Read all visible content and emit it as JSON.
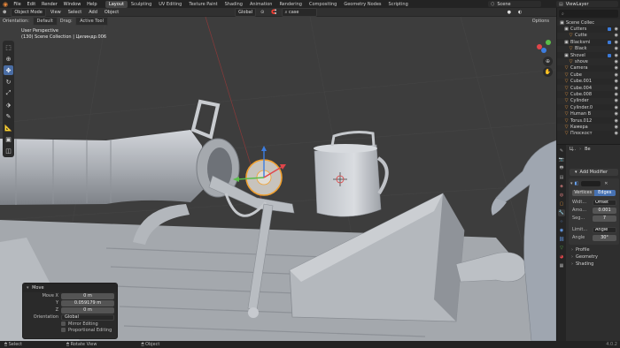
{
  "topbar": {
    "menus": [
      "File",
      "Edit",
      "Render",
      "Window",
      "Help"
    ],
    "workspaces": [
      "Layout",
      "Sculpting",
      "UV Editing",
      "Texture Paint",
      "Shading",
      "Animation",
      "Rendering",
      "Compositing",
      "Geometry Nodes",
      "Scripting"
    ],
    "active_workspace": "Layout",
    "scene": "Scene",
    "view_layer": "ViewLayer"
  },
  "header": {
    "mode": "Object Mode",
    "menus": [
      "View",
      "Select",
      "Add",
      "Object"
    ],
    "transform_orientation": "Global",
    "search_value": "case",
    "options_label": "Options"
  },
  "tool_settings": {
    "orientation_label": "Orientation:",
    "orientation_value": "Default",
    "drag_label": "Drag:",
    "drag_value": "Active Tool"
  },
  "viewport": {
    "view_name": "User Perspective",
    "collection_info": "(130) Scene Collection | Цилиндр.006"
  },
  "operator_panel": {
    "title": "Move",
    "fields": [
      {
        "label": "Move X",
        "value": "0 m"
      },
      {
        "label": "Y",
        "value": "0.059179 m"
      },
      {
        "label": "Z",
        "value": "0 m"
      }
    ],
    "orientation_label": "Orientation",
    "orientation_value": "Global",
    "checks": [
      "Mirror Editing",
      "Proportional Editing"
    ]
  },
  "statusbar": {
    "items": [
      "Select",
      "Rotate View",
      "Object"
    ],
    "version": "4.0.2"
  },
  "outliner": {
    "title": "Scene Collec",
    "rows": [
      {
        "name": "Cutters",
        "type": "collection",
        "indent": 1
      },
      {
        "name": "Cutte",
        "type": "object",
        "indent": 2
      },
      {
        "name": "Blacksmi",
        "type": "collection",
        "indent": 1
      },
      {
        "name": "Black",
        "type": "object",
        "indent": 2
      },
      {
        "name": "Shovel",
        "type": "collection",
        "indent": 1
      },
      {
        "name": "shove",
        "type": "object",
        "indent": 2
      },
      {
        "name": "Camera",
        "type": "object",
        "indent": 1
      },
      {
        "name": "Cube",
        "type": "object",
        "indent": 1
      },
      {
        "name": "Cube.001",
        "type": "object",
        "indent": 1
      },
      {
        "name": "Cube.004",
        "type": "object",
        "indent": 1
      },
      {
        "name": "Cube.008",
        "type": "object",
        "indent": 1
      },
      {
        "name": "Cylinder",
        "type": "object",
        "indent": 1
      },
      {
        "name": "Cylinder.0",
        "type": "object",
        "indent": 1
      },
      {
        "name": "Human B",
        "type": "object",
        "indent": 1
      },
      {
        "name": "Torus.012",
        "type": "object",
        "indent": 1
      },
      {
        "name": "Камера",
        "type": "object",
        "indent": 1
      },
      {
        "name": "Плоскост",
        "type": "object",
        "indent": 1
      }
    ]
  },
  "properties": {
    "object_name": "Ц..",
    "modifier_short": "Be",
    "add_modifier_label": "Add Modifier",
    "segments": [
      "Vertices",
      "Edges"
    ],
    "active_segment": "Edges",
    "rows": [
      {
        "label": "Widt...",
        "value": "Offset"
      },
      {
        "label": "Amo...",
        "value": "0.001"
      },
      {
        "label": "Seg...",
        "value": "7"
      },
      {
        "label": "Limit...",
        "value": "Angle"
      },
      {
        "label": "Angle",
        "value": "30°"
      }
    ],
    "subpanels": [
      "Profile",
      "Geometry",
      "Shading"
    ]
  },
  "colors": {
    "accent": "#4772b3",
    "object_orange": "#e2943e",
    "gizmo_red": "#e0454a",
    "gizmo_green": "#5bbd4a",
    "gizmo_blue": "#3d7de0",
    "selection": "#f0a030"
  }
}
